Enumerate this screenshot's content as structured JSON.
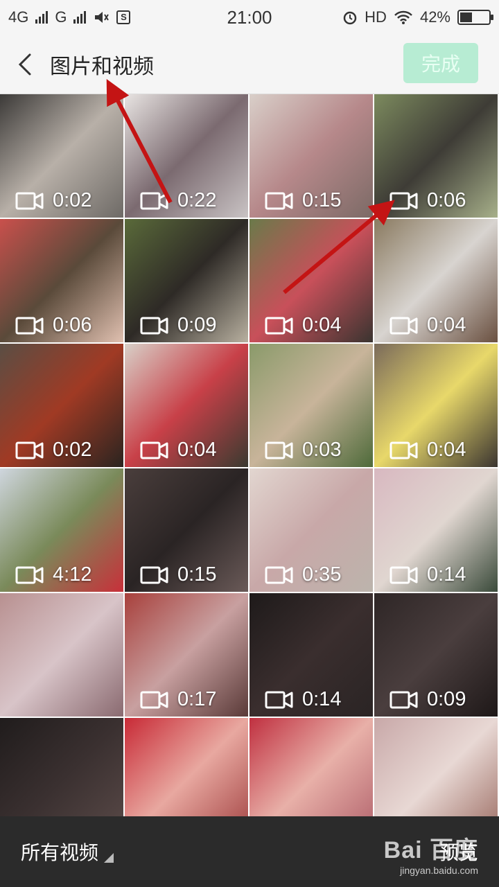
{
  "status_bar": {
    "network1": "4G",
    "network2": "G",
    "time": "21:00",
    "hd": "HD",
    "battery": "42%",
    "battery_level": 0.42
  },
  "header": {
    "title": "图片和视频",
    "done_label": "完成"
  },
  "grid": {
    "items": [
      {
        "duration": "0:02",
        "colors": [
          "#3c3a38",
          "#b8b0a8",
          "#6e6a66"
        ]
      },
      {
        "duration": "0:22",
        "colors": [
          "#e8e4e2",
          "#7b6a70",
          "#c9c3c4"
        ]
      },
      {
        "duration": "0:15",
        "colors": [
          "#d9cfc9",
          "#b6888a",
          "#7c6a66"
        ]
      },
      {
        "duration": "0:06",
        "colors": [
          "#7c8a5e",
          "#3e3c36",
          "#a7b08a"
        ]
      },
      {
        "duration": "0:06",
        "colors": [
          "#c9504c",
          "#5a4a3a",
          "#e0c0b0"
        ]
      },
      {
        "duration": "0:09",
        "colors": [
          "#5a6a3a",
          "#2e2a26",
          "#b8b0a0"
        ]
      },
      {
        "duration": "0:04",
        "colors": [
          "#6a7a4a",
          "#c8505a",
          "#3a3430"
        ]
      },
      {
        "duration": "0:04",
        "colors": [
          "#8a7a60",
          "#d8d4d0",
          "#6a5040"
        ]
      },
      {
        "duration": "0:02",
        "colors": [
          "#5a4e44",
          "#a03a24",
          "#2a2420"
        ]
      },
      {
        "duration": "0:04",
        "colors": [
          "#d8d0c8",
          "#c84048",
          "#3a3a30"
        ]
      },
      {
        "duration": "0:03",
        "colors": [
          "#8a9a6a",
          "#c8b49a",
          "#4e6a3a"
        ]
      },
      {
        "duration": "0:04",
        "colors": [
          "#7a6a5a",
          "#e8d86a",
          "#3a3430"
        ]
      },
      {
        "duration": "4:12",
        "colors": [
          "#cfd6de",
          "#7a8a5a",
          "#c8303a"
        ]
      },
      {
        "duration": "0:15",
        "colors": [
          "#4a3e3c",
          "#2a2424",
          "#6a5a58"
        ]
      },
      {
        "duration": "0:35",
        "colors": [
          "#e2d6d0",
          "#c8a8a8",
          "#bcb4ac"
        ]
      },
      {
        "duration": "0:14",
        "colors": [
          "#d8b8c0",
          "#e0d6d0",
          "#3a4a3a"
        ]
      },
      {
        "duration": "",
        "colors": [
          "#b89090",
          "#d8c4c8",
          "#8a6a70"
        ]
      },
      {
        "duration": "0:17",
        "colors": [
          "#a8403c",
          "#c8a0a0",
          "#5a3a38"
        ]
      },
      {
        "duration": "0:14",
        "colors": [
          "#1e1a1a",
          "#3a2e2e",
          "#2a2424"
        ]
      },
      {
        "duration": "0:09",
        "colors": [
          "#2e2626",
          "#4a3e3e",
          "#1e1818"
        ]
      },
      {
        "duration": "",
        "colors": [
          "#201c1c",
          "#3a3030",
          "#5a4a48"
        ]
      },
      {
        "duration": "",
        "colors": [
          "#c82a36",
          "#e8a8a0",
          "#a04040"
        ]
      },
      {
        "duration": "",
        "colors": [
          "#c03040",
          "#e8b0a8",
          "#b0606a"
        ]
      },
      {
        "duration": "",
        "colors": [
          "#c8a8a8",
          "#e8d8d4",
          "#9a6a60"
        ]
      }
    ]
  },
  "bottom_bar": {
    "album_label": "所有视频",
    "preview_label": "预览",
    "watermark_logo": "Bai 百度",
    "watermark_url": "jingyan.baidu.com"
  }
}
